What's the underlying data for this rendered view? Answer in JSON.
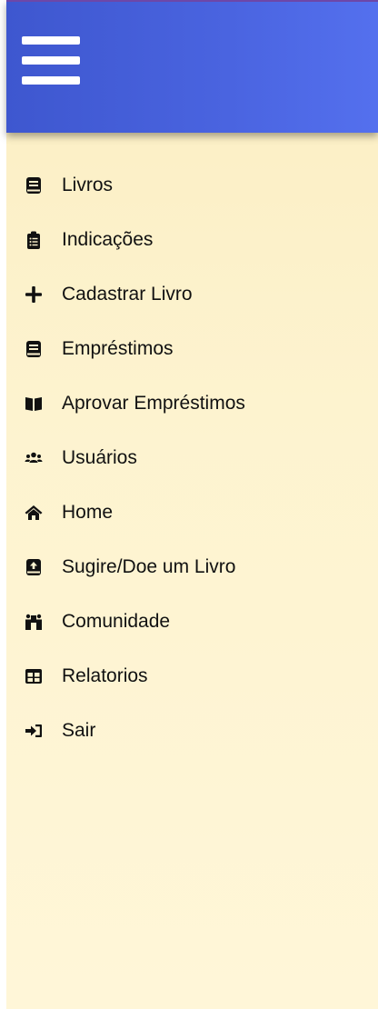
{
  "header": {
    "menu_icon": "hamburger-menu-icon"
  },
  "nav": {
    "items": [
      {
        "label": "Livros",
        "icon": "book-icon"
      },
      {
        "label": "Indicações",
        "icon": "clipboard-list-icon"
      },
      {
        "label": "Cadastrar Livro",
        "icon": "plus-icon"
      },
      {
        "label": "Empréstimos",
        "icon": "book-icon"
      },
      {
        "label": "Aprovar Empréstimos",
        "icon": "open-book-icon"
      },
      {
        "label": "Usuários",
        "icon": "users-icon"
      },
      {
        "label": "Home",
        "icon": "home-icon"
      },
      {
        "label": "Sugire/Doe um Livro",
        "icon": "book-upload-icon"
      },
      {
        "label": "Comunidade",
        "icon": "people-carry-icon"
      },
      {
        "label": "Relatorios",
        "icon": "table-icon"
      },
      {
        "label": "Sair",
        "icon": "sign-out-icon"
      }
    ]
  },
  "colors": {
    "header": "#4a64e0",
    "background": "#fdf3cf",
    "text": "#111111"
  }
}
